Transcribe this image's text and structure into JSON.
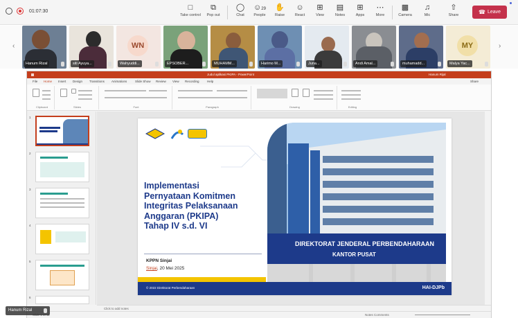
{
  "meeting": {
    "timer": "01:07:30",
    "toolbar": [
      {
        "label": "Take control",
        "icon": "take-control-icon"
      },
      {
        "label": "Pop out",
        "icon": "pop-out-icon"
      },
      {
        "label": "Chat",
        "icon": "chat-icon"
      },
      {
        "label": "People",
        "icon": "people-icon",
        "count": "29"
      },
      {
        "label": "Raise",
        "icon": "raise-hand-icon"
      },
      {
        "label": "React",
        "icon": "react-icon"
      },
      {
        "label": "View",
        "icon": "view-icon"
      },
      {
        "label": "Notes",
        "icon": "notes-icon"
      },
      {
        "label": "Apps",
        "icon": "apps-icon"
      },
      {
        "label": "More",
        "icon": "more-icon"
      },
      {
        "label": "Camera",
        "icon": "camera-icon"
      },
      {
        "label": "Mic",
        "icon": "mic-icon"
      },
      {
        "label": "Share",
        "icon": "share-icon"
      }
    ],
    "leave_label": "Leave",
    "accent": "#c4314b",
    "presenter_tag": "Hanum Rizal"
  },
  "participants": [
    {
      "name": "Hanum Rizal"
    },
    {
      "name": "siti Ayuya..."
    },
    {
      "name": "Wahyuddi...",
      "initials": "WN"
    },
    {
      "name": "EPSOBER..."
    },
    {
      "name": "MUHAMM..."
    },
    {
      "name": "Harimo M..."
    },
    {
      "name": "Juna..."
    },
    {
      "name": "Andi Amal..."
    },
    {
      "name": "muhamadd..."
    },
    {
      "name": "Malya Yac...",
      "initials": "MY"
    }
  ],
  "powerpoint": {
    "title": "Judul aplikasi PKIPA - PowerPoint",
    "user": "Hanum Rijal",
    "share_label": "Share",
    "tabs": [
      "File",
      "Home",
      "Insert",
      "Design",
      "Transitions",
      "Animations",
      "Slide Show",
      "Review",
      "View",
      "Recording",
      "Help"
    ],
    "active_tab": "Home",
    "ribbon_groups": [
      "Clipboard",
      "Slides",
      "Font",
      "Paragraph",
      "Drawing",
      "Editing"
    ],
    "slide_count": "7",
    "notes_placeholder": "Click to add notes",
    "status_left": "Slide 1 of 11",
    "status_right": "Notes   Comments",
    "accent": "#c43e1c"
  },
  "slide": {
    "title_lines": [
      "Implementasi",
      "Pernyataan Komitmen",
      "Integritas Pelaksanaan",
      "Anggaran (PKIPA)",
      "Tahap IV s.d. VI"
    ],
    "org": "KPPN Sinjai",
    "date_prefix": "Sinjai",
    "date_rest": ", 20 Mei 2025",
    "footer": "© 2022 Direktorat Perbendaharaan",
    "brand": "HAI-DJPb",
    "building_sign_1": "DIREKTORAT JENDERAL PERBENDAHARAAN",
    "building_sign_2": "KANTOR PUSAT",
    "title_color": "#1d3a8a"
  }
}
